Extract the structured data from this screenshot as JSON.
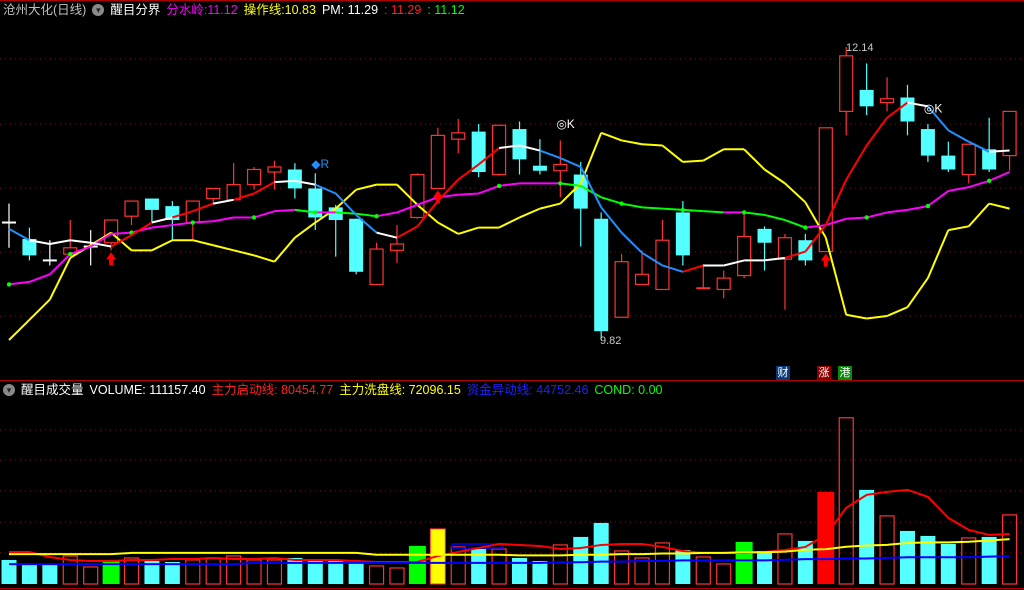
{
  "header": {
    "stock": "沧州大化(日线)",
    "indicator": "醒目分界",
    "fenshuiling_label": "分水岭:",
    "fenshuiling_value": "11.12",
    "caozuo_label": "操作线:",
    "caozuo_value": "10.83",
    "pm_label": "PM:",
    "pm_value": "11.29",
    "red_value": ": 11.29",
    "green_value": ": 11.12"
  },
  "volume_header": {
    "indicator": "醒目成交量",
    "volume_label": "VOLUME:",
    "volume_value": "111157.40",
    "start_label": "主力启动线:",
    "start_value": "80454.77",
    "wash_label": "主力洗盘线:",
    "wash_value": "72096.15",
    "abnormal_label": "资金异动线:",
    "abnormal_value": "44752.46",
    "cond_label": "COND:",
    "cond_value": "0.00"
  },
  "badges": {
    "cai": "财",
    "zhang": "涨",
    "gang": "港"
  },
  "colors": {
    "up": "#ff3232",
    "down": "#54ffff",
    "magenta": "#ff00ff",
    "yellow": "#ffff00",
    "green": "#00ff00",
    "blue": "#1e90ff",
    "grid": "#8b0000"
  },
  "chart_data": [
    {
      "type": "candlestick",
      "title": "醒目分界",
      "price_range": [
        9.52,
        12.35
      ],
      "high_label": "12.14",
      "low_label": "9.82",
      "candles": [
        {
          "o": 10.75,
          "h": 10.9,
          "l": 10.55,
          "c": 10.75
        },
        {
          "o": 10.62,
          "h": 10.71,
          "l": 10.45,
          "c": 10.49
        },
        {
          "o": 10.45,
          "h": 10.61,
          "l": 10.41,
          "c": 10.45
        },
        {
          "o": 10.5,
          "h": 10.77,
          "l": 10.5,
          "c": 10.55
        },
        {
          "o": 10.56,
          "h": 10.69,
          "l": 10.41,
          "c": 10.56
        },
        {
          "o": 10.59,
          "h": 10.77,
          "l": 10.53,
          "c": 10.77
        },
        {
          "o": 10.8,
          "h": 10.92,
          "l": 10.73,
          "c": 10.92
        },
        {
          "o": 10.94,
          "h": 10.94,
          "l": 10.75,
          "c": 10.85
        },
        {
          "o": 10.88,
          "h": 10.92,
          "l": 10.61,
          "c": 10.77
        },
        {
          "o": 10.75,
          "h": 10.92,
          "l": 10.61,
          "c": 10.92
        },
        {
          "o": 10.94,
          "h": 11.02,
          "l": 10.89,
          "c": 11.02
        },
        {
          "o": 10.93,
          "h": 11.22,
          "l": 10.93,
          "c": 11.05
        },
        {
          "o": 11.05,
          "h": 11.19,
          "l": 11.01,
          "c": 11.17
        },
        {
          "o": 11.15,
          "h": 11.24,
          "l": 11.01,
          "c": 11.19
        },
        {
          "o": 11.17,
          "h": 11.22,
          "l": 10.94,
          "c": 11.02
        },
        {
          "o": 11.02,
          "h": 11.14,
          "l": 10.69,
          "c": 10.79
        },
        {
          "o": 10.87,
          "h": 10.89,
          "l": 10.48,
          "c": 10.77
        },
        {
          "o": 10.78,
          "h": 10.78,
          "l": 10.34,
          "c": 10.36
        },
        {
          "o": 10.26,
          "h": 10.59,
          "l": 10.26,
          "c": 10.54
        },
        {
          "o": 10.53,
          "h": 10.73,
          "l": 10.43,
          "c": 10.58
        },
        {
          "o": 10.79,
          "h": 11.14,
          "l": 10.78,
          "c": 11.13
        },
        {
          "o": 11.02,
          "h": 11.5,
          "l": 11.02,
          "c": 11.44
        },
        {
          "o": 11.41,
          "h": 11.57,
          "l": 11.3,
          "c": 11.46
        },
        {
          "o": 11.47,
          "h": 11.53,
          "l": 11.11,
          "c": 11.15
        },
        {
          "o": 11.13,
          "h": 11.52,
          "l": 11.12,
          "c": 11.52
        },
        {
          "o": 11.49,
          "h": 11.55,
          "l": 11.13,
          "c": 11.25
        },
        {
          "o": 11.2,
          "h": 11.41,
          "l": 11.13,
          "c": 11.16
        },
        {
          "o": 11.16,
          "h": 11.4,
          "l": 10.95,
          "c": 11.21
        },
        {
          "o": 11.13,
          "h": 11.23,
          "l": 10.56,
          "c": 10.86
        },
        {
          "o": 10.78,
          "h": 10.83,
          "l": 9.82,
          "c": 9.89
        },
        {
          "o": 10.0,
          "h": 10.5,
          "l": 10.0,
          "c": 10.44
        },
        {
          "o": 10.26,
          "h": 10.53,
          "l": 10.26,
          "c": 10.34
        },
        {
          "o": 10.22,
          "h": 10.77,
          "l": 10.22,
          "c": 10.61
        },
        {
          "o": 10.83,
          "h": 10.92,
          "l": 10.41,
          "c": 10.49
        },
        {
          "o": 10.23,
          "h": 10.42,
          "l": 10.23,
          "c": 10.23
        },
        {
          "o": 10.22,
          "h": 10.37,
          "l": 10.15,
          "c": 10.31
        },
        {
          "o": 10.33,
          "h": 10.83,
          "l": 10.31,
          "c": 10.64
        },
        {
          "o": 10.7,
          "h": 10.72,
          "l": 10.37,
          "c": 10.59
        },
        {
          "o": 10.46,
          "h": 10.66,
          "l": 10.06,
          "c": 10.63
        },
        {
          "o": 10.61,
          "h": 10.66,
          "l": 10.41,
          "c": 10.45
        },
        {
          "o": 10.52,
          "h": 11.5,
          "l": 10.52,
          "c": 11.5
        },
        {
          "o": 11.63,
          "h": 12.14,
          "l": 11.44,
          "c": 12.07
        },
        {
          "o": 11.8,
          "h": 12.01,
          "l": 11.6,
          "c": 11.67
        },
        {
          "o": 11.7,
          "h": 11.9,
          "l": 11.63,
          "c": 11.73
        },
        {
          "o": 11.74,
          "h": 11.84,
          "l": 11.44,
          "c": 11.55
        },
        {
          "o": 11.49,
          "h": 11.53,
          "l": 11.23,
          "c": 11.28
        },
        {
          "o": 11.28,
          "h": 11.39,
          "l": 11.15,
          "c": 11.17
        },
        {
          "o": 11.13,
          "h": 11.37,
          "l": 11.06,
          "c": 11.37
        },
        {
          "o": 11.33,
          "h": 11.58,
          "l": 11.15,
          "c": 11.17
        },
        {
          "o": 11.28,
          "h": 11.63,
          "l": 11.16,
          "c": 11.63
        }
      ],
      "series": [
        {
          "name": "分水岭",
          "values": [
            10.26,
            10.28,
            10.34,
            10.5,
            10.56,
            10.66,
            10.67,
            10.71,
            10.73,
            10.75,
            10.76,
            10.79,
            10.79,
            10.84,
            10.85,
            10.83,
            10.83,
            10.82,
            10.8,
            10.83,
            10.89,
            10.95,
            10.97,
            10.98,
            11.04,
            11.06,
            11.06,
            11.06,
            11.04,
            10.95,
            10.9,
            10.87,
            10.86,
            10.85,
            10.84,
            10.83,
            10.83,
            10.81,
            10.77,
            10.71,
            10.73,
            10.78,
            10.79,
            10.83,
            10.85,
            10.88,
            11.0,
            11.03,
            11.08,
            11.15
          ]
        },
        {
          "name": "PM",
          "values": [
            9.82,
            9.98,
            10.14,
            10.47,
            10.57,
            10.67,
            10.53,
            10.53,
            10.61,
            10.61,
            10.57,
            10.53,
            10.49,
            10.44,
            10.63,
            10.75,
            10.86,
            11.01,
            11.05,
            11.05,
            10.89,
            10.75,
            10.66,
            10.71,
            10.71,
            10.79,
            10.86,
            10.9,
            11.06,
            11.46,
            11.4,
            11.37,
            11.36,
            11.23,
            11.24,
            11.33,
            11.33,
            11.17,
            11.06,
            10.91,
            10.63,
            10.02,
            9.99,
            10.01,
            10.08,
            10.31,
            10.69,
            10.72,
            10.9,
            10.86
          ]
        },
        {
          "name": "操作线",
          "values": [
            10.7,
            10.61,
            10.58,
            10.61,
            10.59,
            10.56,
            10.65,
            10.75,
            10.79,
            10.84,
            10.9,
            10.93,
            10.98,
            11.07,
            11.08,
            11.05,
            10.98,
            10.81,
            10.67,
            10.63,
            10.72,
            10.92,
            11.09,
            11.21,
            11.34,
            11.36,
            11.32,
            11.26,
            11.19,
            10.87,
            10.67,
            10.51,
            10.41,
            10.36,
            10.41,
            10.41,
            10.45,
            10.45,
            10.47,
            10.52,
            10.73,
            11.09,
            11.36,
            11.58,
            11.7,
            11.67,
            11.48,
            11.39,
            11.31,
            11.32
          ]
        }
      ],
      "annotations": [
        {
          "text": "◆R",
          "index": 15,
          "price": 11.18,
          "color": "#1e90ff"
        },
        {
          "text": "◎K",
          "index": 27,
          "price": 11.5,
          "color": "#ffffff"
        },
        {
          "text": "◎K",
          "index": 45,
          "price": 11.62,
          "color": "#ffffff"
        }
      ],
      "buy_arrows": [
        5,
        21,
        40
      ]
    },
    {
      "type": "bar",
      "title": "醒目成交量",
      "ylim": [
        0,
        296000
      ],
      "volumes": [
        38664,
        30609,
        30609,
        45108,
        27387,
        38664,
        41886,
        37053,
        35442,
        38664,
        41886,
        45108,
        38664,
        38664,
        41886,
        38664,
        38664,
        35442,
        28998,
        25776,
        61218,
        88605,
        59607,
        56385,
        56385,
        41886,
        37053,
        62829,
        75717,
        98271,
        53163,
        41886,
        66051,
        54774,
        43497,
        32220,
        67662,
        53163,
        80550,
        69273,
        148212,
        267426,
        151434,
        109548,
        85383,
        77328,
        64440,
        74106,
        75717,
        111157.4
      ],
      "bar_styles": [
        "down",
        "down",
        "down",
        "up",
        "up",
        "green",
        "up",
        "down",
        "down",
        "up",
        "up",
        "up",
        "up",
        "up",
        "down",
        "down",
        "down",
        "down",
        "up",
        "up",
        "green",
        "yellow",
        "up",
        "down",
        "up",
        "down",
        "down",
        "up",
        "down",
        "down",
        "up",
        "up",
        "up",
        "down",
        "up",
        "up",
        "green",
        "down",
        "up",
        "down",
        "redfill",
        "up",
        "down",
        "up",
        "down",
        "down",
        "down",
        "up",
        "down",
        "up"
      ],
      "series": [
        {
          "name": "主力启动线",
          "color": "#ff0000",
          "values": [
            51552,
            51552,
            43497,
            38664,
            37053,
            37053,
            38664,
            38664,
            40275,
            40275,
            41886,
            40275,
            40275,
            41886,
            38664,
            38664,
            38664,
            37053,
            35442,
            35442,
            35442,
            45108,
            51552,
            57996,
            64440,
            62829,
            61218,
            56385,
            57996,
            62829,
            64440,
            64440,
            59607,
            53163,
            49941,
            49941,
            49941,
            51552,
            54774,
            59607,
            78939,
            122436,
            143379,
            148212,
            151434,
            140157,
            106326,
            86994,
            78939,
            80454.77
          ]
        },
        {
          "name": "主力洗盘线",
          "color": "#ffff00",
          "values": [
            48000,
            48000,
            48000,
            48000,
            48000,
            48000,
            50000,
            50000,
            50000,
            50000,
            50000,
            50000,
            50000,
            50000,
            50000,
            50000,
            50000,
            50000,
            47000,
            47000,
            47000,
            47000,
            47000,
            47000,
            47000,
            46000,
            46000,
            46000,
            47000,
            47000,
            48000,
            48000,
            49000,
            49000,
            50000,
            50000,
            51000,
            51000,
            52000,
            55000,
            56000,
            60000,
            62000,
            63000,
            66000,
            67000,
            67000,
            68000,
            70000,
            72096.15
          ]
        },
        {
          "name": "资金异动线",
          "color": "#0000ff",
          "values": [
            32000,
            32000,
            32000,
            32000,
            32000,
            32000,
            32000,
            32000,
            32000,
            32000,
            32000,
            32000,
            34000,
            34000,
            34000,
            34000,
            34000,
            34000,
            34000,
            34000,
            34000,
            34000,
            34000,
            34000,
            34000,
            34000,
            34000,
            35000,
            35000,
            36000,
            36000,
            37000,
            37000,
            38000,
            38000,
            38000,
            38000,
            38000,
            39000,
            40000,
            40000,
            41000,
            41000,
            42000,
            43000,
            43000,
            43000,
            43000,
            44000,
            44752.46
          ]
        }
      ]
    }
  ]
}
